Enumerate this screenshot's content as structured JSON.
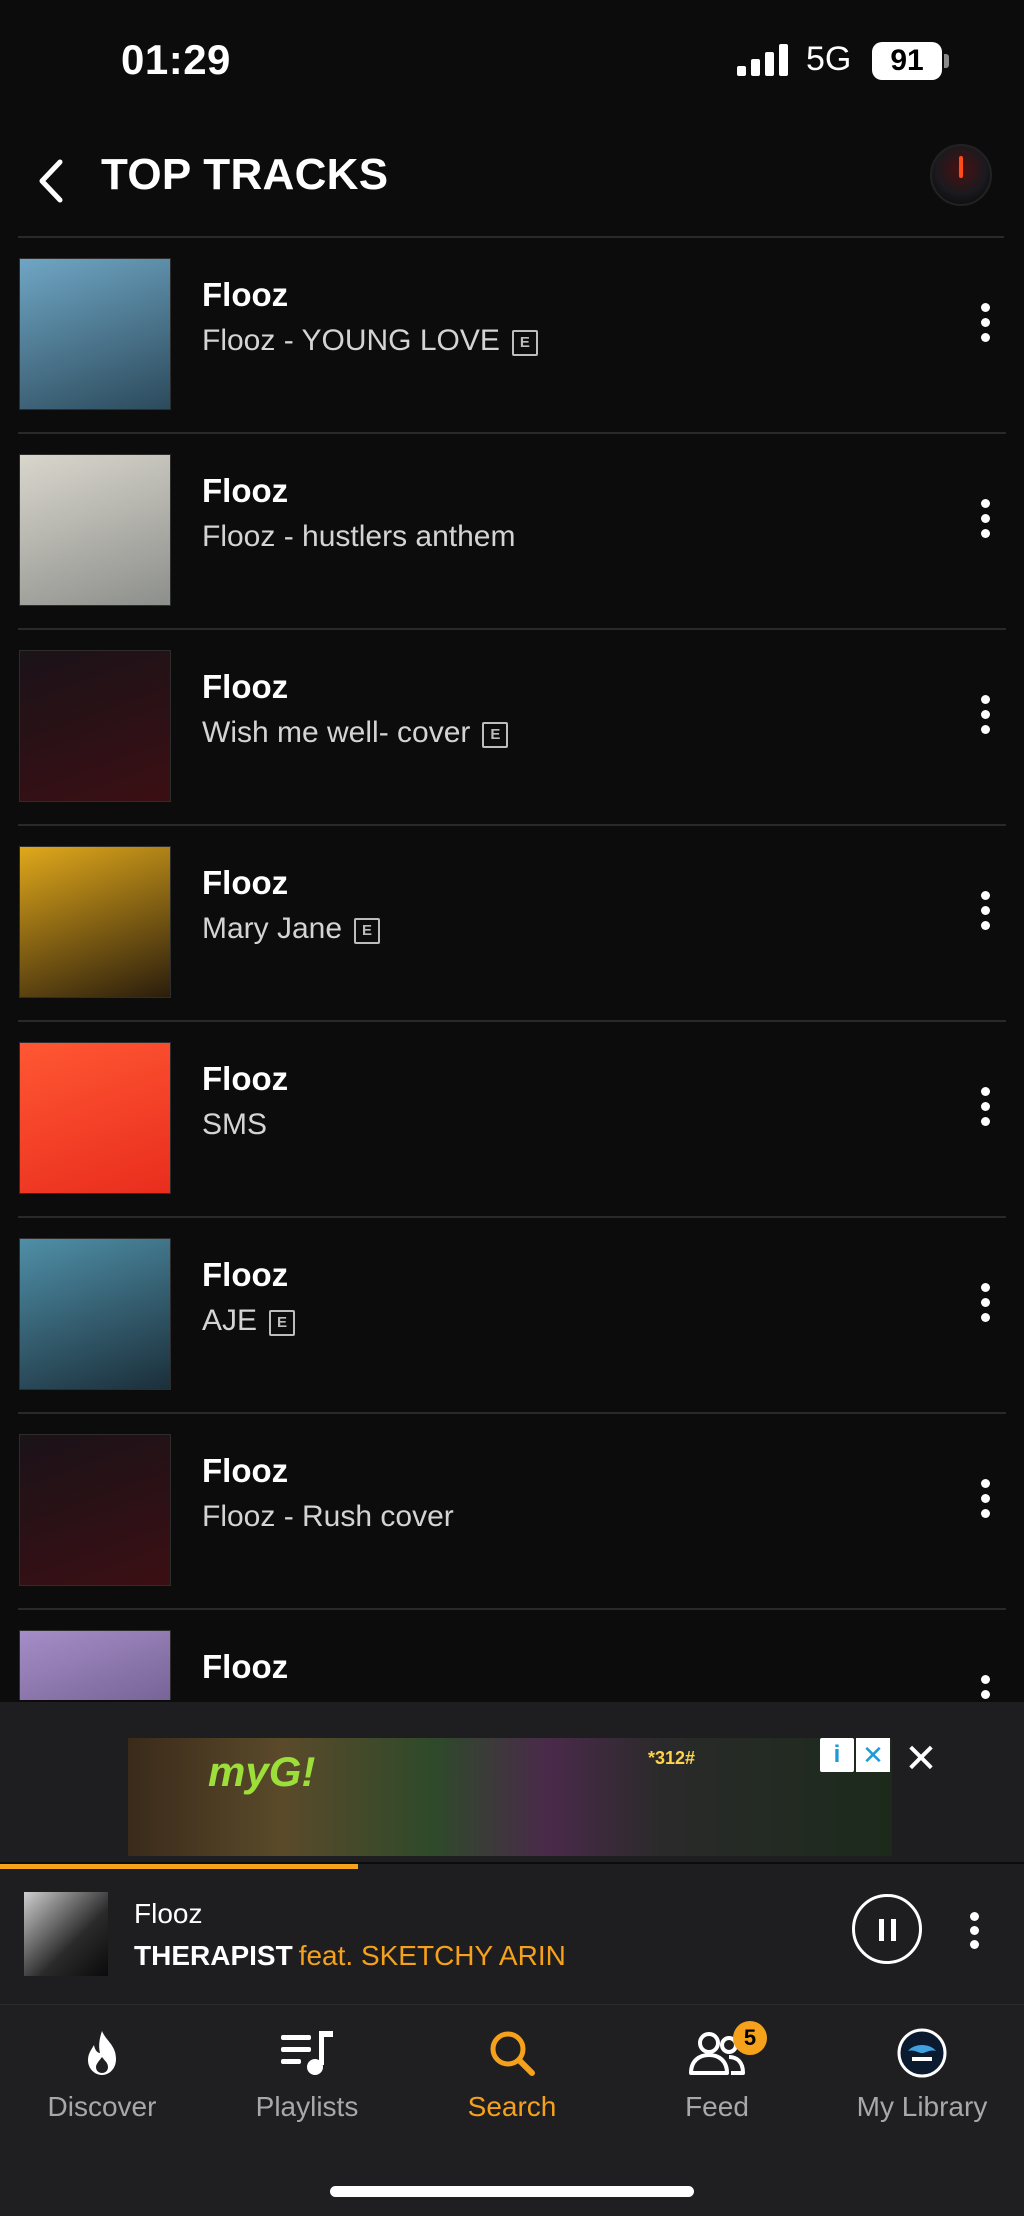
{
  "status": {
    "time": "01:29",
    "network": "5G",
    "battery": "91"
  },
  "header": {
    "title": "TOP TRACKS"
  },
  "tracks": [
    {
      "artist": "Flooz",
      "title": "Flooz - YOUNG LOVE",
      "explicit": true,
      "art_colors": [
        "#6fa6c4",
        "#2c4a5c"
      ]
    },
    {
      "artist": "Flooz",
      "title": "Flooz -  hustlers anthem",
      "explicit": false,
      "art_colors": [
        "#d9d6cc",
        "#8d8f8c"
      ]
    },
    {
      "artist": "Flooz",
      "title": "Wish me well- cover",
      "explicit": true,
      "art_colors": [
        "#1a1318",
        "#3b0f14"
      ]
    },
    {
      "artist": "Flooz",
      "title": "Mary Jane",
      "explicit": true,
      "art_colors": [
        "#e0a81b",
        "#2a1d0c"
      ]
    },
    {
      "artist": "Flooz",
      "title": "SMS",
      "explicit": false,
      "art_colors": [
        "#ff5733",
        "#e92d1d"
      ]
    },
    {
      "artist": "Flooz",
      "title": "AJE",
      "explicit": true,
      "art_colors": [
        "#4f8fa8",
        "#1b2f3a"
      ]
    },
    {
      "artist": "Flooz",
      "title": "Flooz - Rush cover",
      "explicit": false,
      "art_colors": [
        "#1a1318",
        "#3b0f14"
      ]
    },
    {
      "artist": "Flooz",
      "title": "",
      "explicit": false,
      "art_colors": [
        "#a58dc7",
        "#5a4a78"
      ]
    }
  ],
  "explicit_mark": "E",
  "ad": {
    "logo": "myG!",
    "code": "*312#",
    "info_label": "i",
    "close_label": "✕",
    "close_small_label": "✕"
  },
  "now_playing": {
    "artist": "Flooz",
    "title": "THERAPIST",
    "featuring": "feat. SKETCHY ARIN",
    "progress": 0.35
  },
  "tabs": [
    {
      "label": "Discover",
      "icon": "flame-icon",
      "active": false
    },
    {
      "label": "Playlists",
      "icon": "playlist-icon",
      "active": false
    },
    {
      "label": "Search",
      "icon": "search-icon",
      "active": true
    },
    {
      "label": "Feed",
      "icon": "people-icon",
      "active": false,
      "badge": "5"
    },
    {
      "label": "My Library",
      "icon": "library-avatar-icon",
      "active": false
    }
  ],
  "colors": {
    "accent": "#f5a11b",
    "background": "#0c0c0d",
    "bar": "#1f1f22"
  }
}
